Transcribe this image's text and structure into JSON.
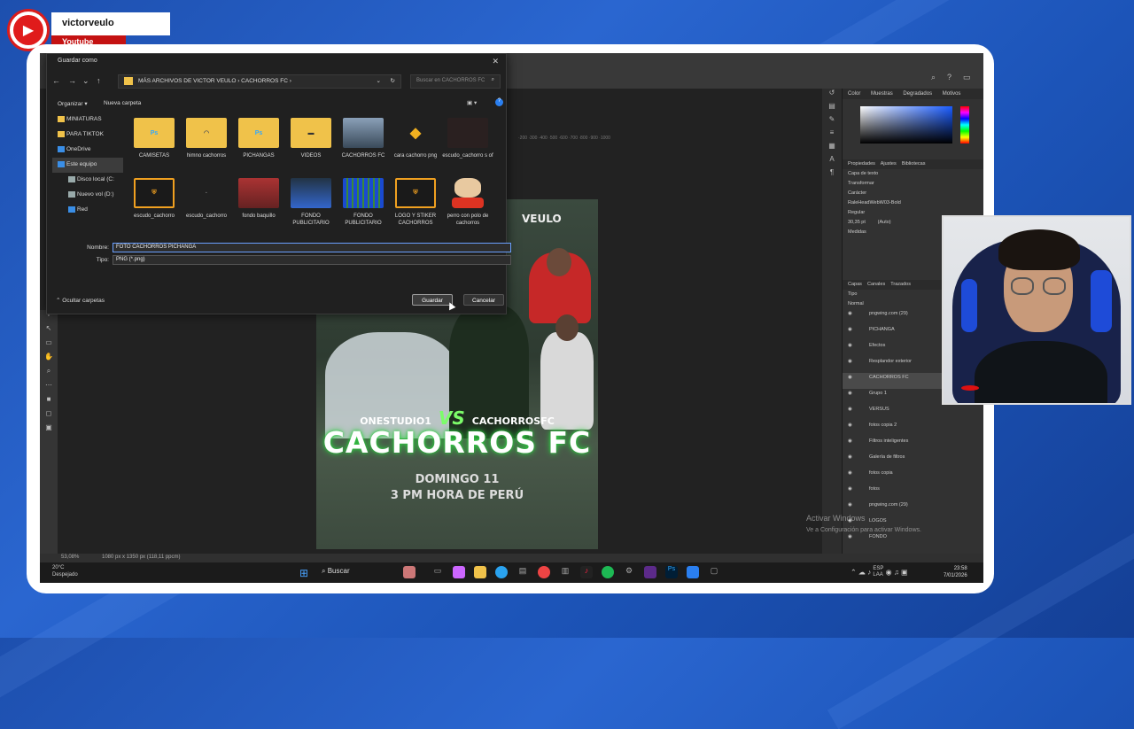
{
  "channel": {
    "name": "victorveulo",
    "platform": "Youtube",
    "icon": "youtube-play-icon"
  },
  "dialog": {
    "title": "Guardar como",
    "breadcrumb": "MÁS ARCHIVOS DE VICTOR VEULO  ›  CACHORROS FC  ›",
    "search_placeholder": "Buscar en CACHORROS FC",
    "organize": "Organizar ▾",
    "new_folder": "Nueva carpeta",
    "nav": [
      {
        "label": "MINIATURAS",
        "color": "#f0c24a"
      },
      {
        "label": "PARA TIKTOK",
        "color": "#f0c24a"
      },
      {
        "label": "OneDrive",
        "color": "#3a8ee6"
      },
      {
        "label": "Este equipo",
        "color": "#3a8ee6"
      },
      {
        "label": "Disco local (C:",
        "color": "#9aa"
      },
      {
        "label": "Nuevo vol (D:)",
        "color": "#9aa"
      },
      {
        "label": "Red",
        "color": "#3a8ee6"
      }
    ],
    "files": [
      {
        "label": "CAMISETAS",
        "kind": "folder-ps"
      },
      {
        "label": "himno cachorros",
        "kind": "folder"
      },
      {
        "label": "PICHANGAS",
        "kind": "folder-ps"
      },
      {
        "label": "VIDEOS",
        "kind": "folder-video"
      },
      {
        "label": "CACHORROS FC",
        "kind": "photo"
      },
      {
        "label": "cara cachorro png",
        "kind": "dog"
      },
      {
        "label": "escudo_cachorro s of",
        "kind": "dark"
      },
      {
        "label": "escudo_cachorro",
        "kind": "shield"
      },
      {
        "label": "escudo_cachorro",
        "kind": "blank"
      },
      {
        "label": "fondo baquillo",
        "kind": "bottles"
      },
      {
        "label": "FONDO PUBLICITARIO",
        "kind": "blue"
      },
      {
        "label": "FONDO PUBLICITARIO",
        "kind": "grid"
      },
      {
        "label": "LOGO Y STIKER CACHORROS",
        "kind": "shield"
      },
      {
        "label": "perro con polo de cachorros",
        "kind": "dogpolo"
      }
    ],
    "name_label": "Nombre:",
    "name_value": "FOTO CACHORROS PICHANGA",
    "type_label": "Tipo:",
    "type_value": "PNG (*.png)",
    "hide_folders": "Ocultar carpetas",
    "save": "Guardar",
    "cancel": "Cancelar"
  },
  "poster": {
    "brand": "VEULO",
    "team_a": "ONESTUDIO1",
    "vs": "VS",
    "team_b": "CACHORROSFC",
    "title": "CACHORROS FC",
    "date_line1": "DOMINGO 11",
    "date_line2": "3 PM HORA DE PERÚ"
  },
  "photoshop": {
    "tabs": [
      "Color",
      "Muestras",
      "Degradados",
      "Motivos"
    ],
    "props_tabs": [
      "Propiedades",
      "Ajustes",
      "Bibliotecas"
    ],
    "props": [
      "Capa de texto",
      "Transformar",
      "Carácter",
      "RaleHeadWebW03-Bold",
      "Regular",
      "30,35 pt",
      "(Auto)",
      "Medidas"
    ],
    "layer_tabs": [
      "Capas",
      "Canales",
      "Trazados"
    ],
    "layer_filter": "Tipo",
    "blend": "Normal",
    "layers": [
      {
        "label": "pngwing.com (29)"
      },
      {
        "label": "PICHANGA"
      },
      {
        "label": "Efectos"
      },
      {
        "label": "Resplandor exterior"
      },
      {
        "label": "CACHORROS FC",
        "selected": true
      },
      {
        "label": "Grupo 1"
      },
      {
        "label": "VERSUS"
      },
      {
        "label": "fotos copia 2"
      },
      {
        "label": "Filtros inteligentes"
      },
      {
        "label": "Galería de filtros"
      },
      {
        "label": "fotos copia"
      },
      {
        "label": "fotos"
      },
      {
        "label": "pngwing.com (29)"
      },
      {
        "label": "LOGOS"
      },
      {
        "label": "FONDO"
      }
    ],
    "zoom": "53,08%",
    "doc_info": "1080 px x 1350 px (118,11 ppcm)",
    "watermark_1": "Activar Windows",
    "watermark_2": "Ve a Configuración para activar Windows."
  },
  "taskbar": {
    "temp": "20°C",
    "weather": "Despejado",
    "search": "Buscar",
    "lang1": "ESP",
    "lang2": "LAA",
    "time": "23:58",
    "date": "7/01/2026"
  }
}
